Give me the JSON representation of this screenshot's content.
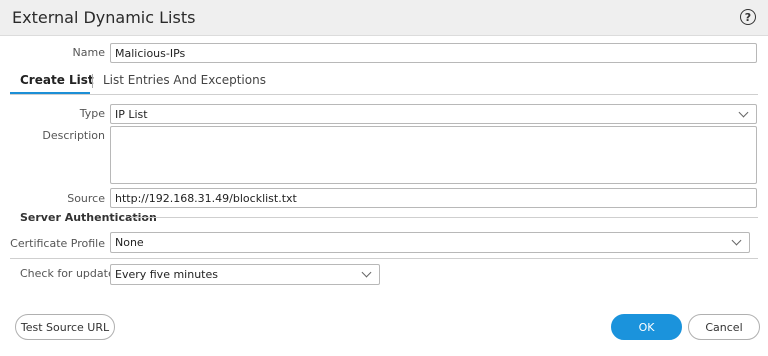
{
  "dialog": {
    "title": "External Dynamic Lists",
    "help_icon": "?"
  },
  "name": {
    "label": "Name",
    "value": "Malicious-IPs"
  },
  "tabs": [
    {
      "label": "Create List",
      "active": true
    },
    {
      "label": "List Entries And Exceptions",
      "active": false
    }
  ],
  "type": {
    "label": "Type",
    "value": "IP List"
  },
  "description": {
    "label": "Description",
    "value": ""
  },
  "source": {
    "label": "Source",
    "value": "http://192.168.31.49/blocklist.txt"
  },
  "server_auth": {
    "title": "Server Authentication",
    "cert_profile": {
      "label": "Certificate Profile",
      "value": "None"
    }
  },
  "updates": {
    "label": "Check for updates",
    "value": "Every five minutes"
  },
  "buttons": {
    "test_source": "Test Source URL",
    "ok": "OK",
    "cancel": "Cancel"
  },
  "colors": {
    "accent": "#1b93dc",
    "title_bar": "#efefef"
  }
}
